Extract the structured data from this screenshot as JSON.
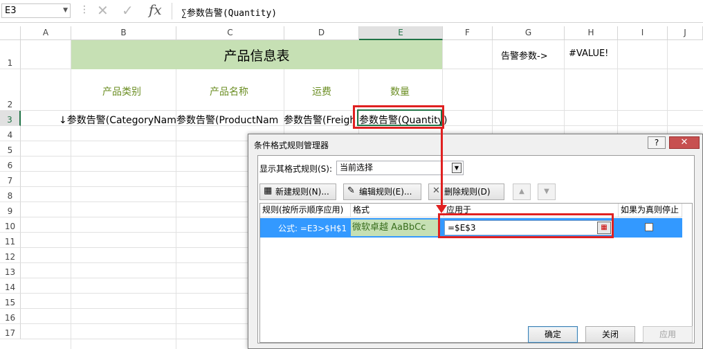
{
  "formula_bar": {
    "name_box": "E3",
    "cancel_icon": "✕",
    "enter_icon": "✓",
    "fx_label": "fx",
    "content": "∑参数告警(Quantity)"
  },
  "columns": [
    "A",
    "B",
    "C",
    "D",
    "E",
    "F",
    "G",
    "H",
    "I",
    "J"
  ],
  "selected_column": "E",
  "rows": [
    "1",
    "2",
    "3",
    "4",
    "5",
    "6",
    "7",
    "8",
    "9",
    "10",
    "11",
    "12",
    "13",
    "14",
    "15",
    "16",
    "17"
  ],
  "selected_row": "3",
  "sheet": {
    "title": "产品信息表",
    "alarm_label": "告警参数->",
    "alarm_value": "#VALUE!",
    "headers": [
      "产品类别",
      "产品名称",
      "运费",
      "数量"
    ],
    "row3": {
      "a": "↓参数告警(CategoryNam",
      "b": "参数告警(ProductNam",
      "c": "参数告警(Freigh",
      "e": "参数告警(Quantity)"
    }
  },
  "dialog": {
    "title": "条件格式规则管理器",
    "help": "?",
    "close": "✕",
    "show_rules_label": "显示其格式规则(S):",
    "show_rules_value": "当前选择",
    "buttons": {
      "new_rule": "新建规则(N)...",
      "edit_rule": "编辑规则(E)...",
      "delete_rule": "删除规则(D)",
      "move_up": "▲",
      "move_down": "▼"
    },
    "table_headers": {
      "rule": "规则(按所示顺序应用)",
      "format": "格式",
      "applies_to": "应用于",
      "stop_if_true": "如果为真则停止"
    },
    "rule_row": {
      "formula": "公式: =E3>$H$1",
      "format_preview": "微软卓越  AaBbCc",
      "applies_to": "=$E$3",
      "stop_if_true": false
    },
    "footer": {
      "ok": "确定",
      "close": "关闭",
      "apply": "应用"
    }
  }
}
